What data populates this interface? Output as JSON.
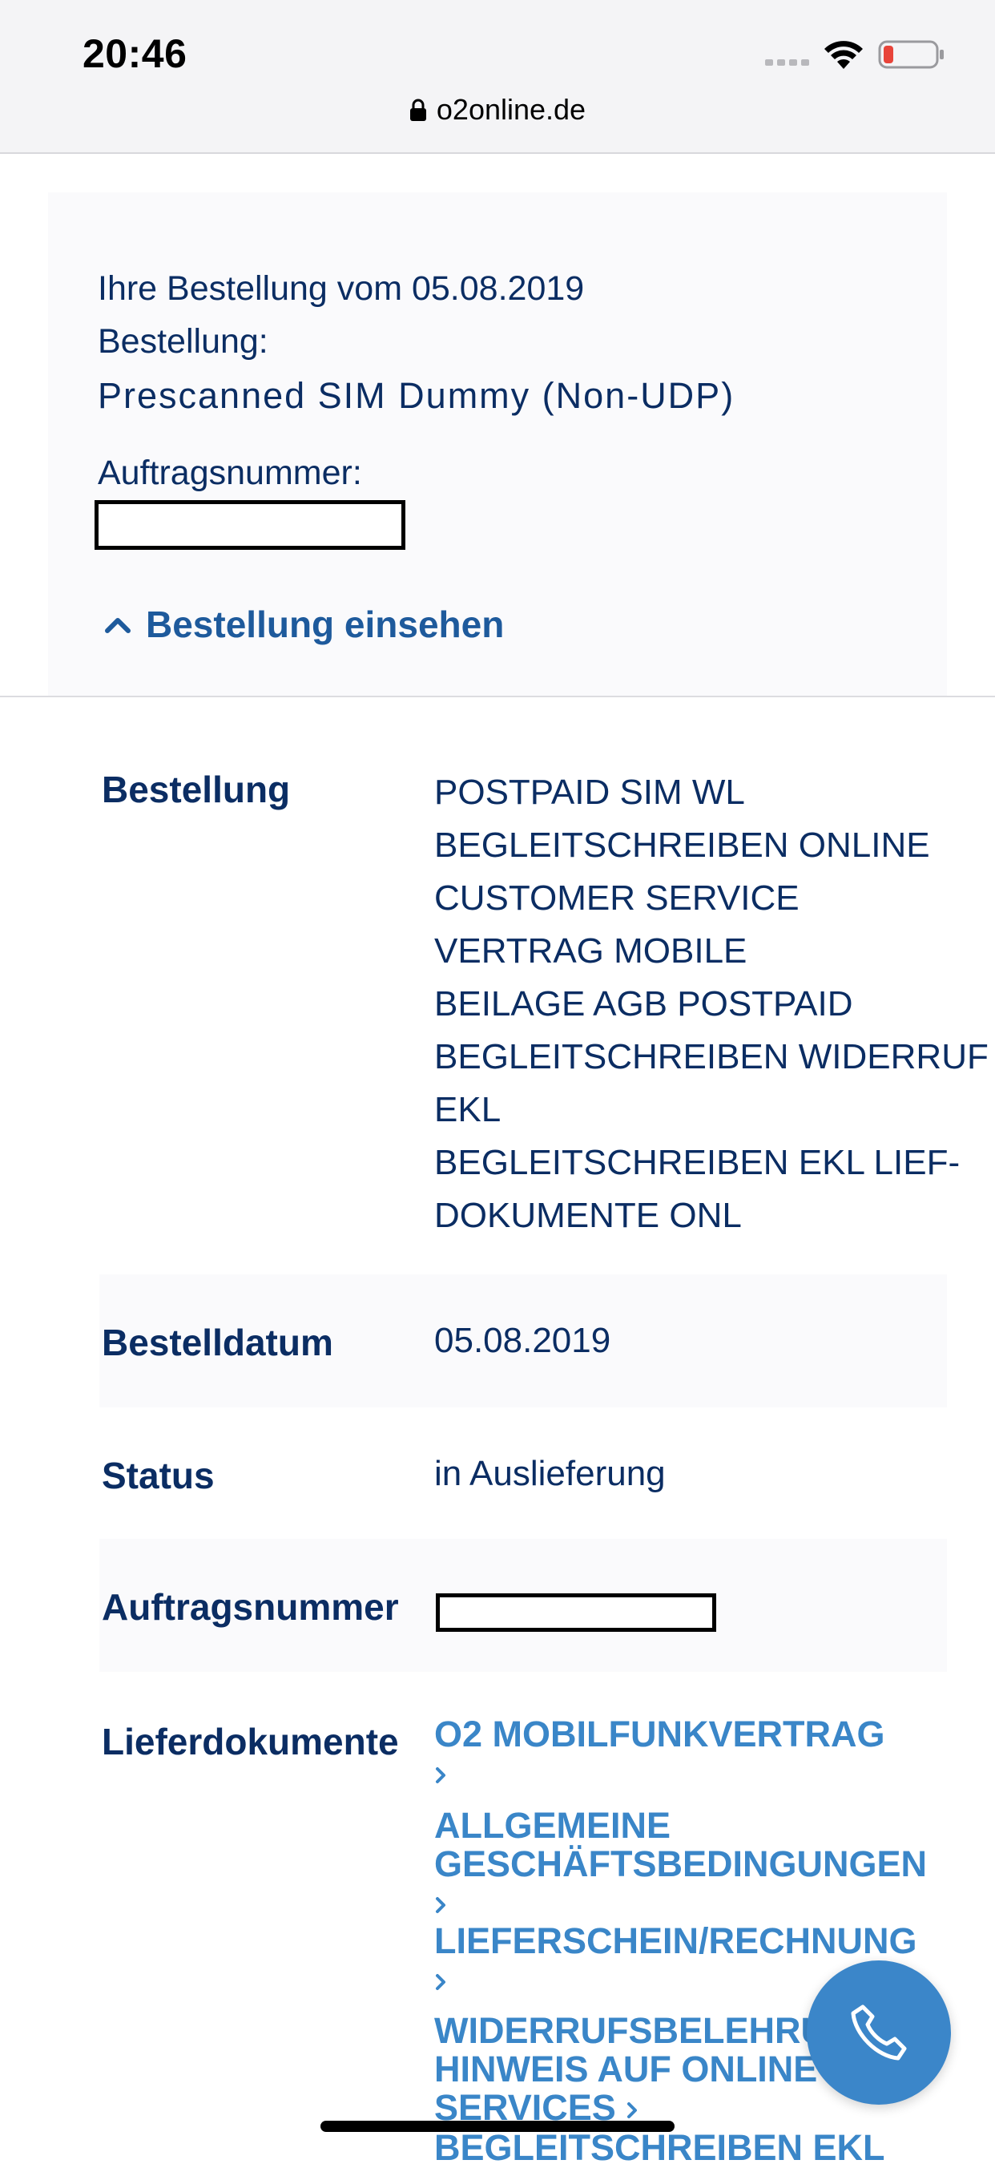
{
  "status_bar": {
    "time": "20:46"
  },
  "browser": {
    "url": "o2online.de"
  },
  "summary": {
    "order_date_line": "Ihre Bestellung vom 05.08.2019",
    "order_label": "Bestellung:",
    "product_name": "Prescanned SIM Dummy (Non-UDP)",
    "order_number_label": "Auftragsnummer:",
    "toggle_label": "Bestellung einsehen"
  },
  "details": {
    "order_label": "Bestellung",
    "order_items": [
      "POSTPAID SIM WL",
      "BEGLEITSCHREIBEN ONLINE",
      "CUSTOMER SERVICE",
      "VERTRAG MOBILE",
      "BEILAGE AGB POSTPAID",
      "BEGLEITSCHREIBEN WIDERRUF",
      "EKL",
      "BEGLEITSCHREIBEN EKL LIEF-",
      "DOKUMENTE ONL"
    ],
    "date_label": "Bestelldatum",
    "date_value": "05.08.2019",
    "status_label": "Status",
    "status_value": "in Auslieferung",
    "order_number_label": "Auftragsnummer",
    "documents_label": "Lieferdokumente",
    "documents": [
      "O2 MOBILFUNKVERTRAG",
      "ALLGEMEINE",
      "GESCHÄFTSBEDINGUNGEN",
      "LIEFERSCHEIN/RECHNUNG",
      "WIDERRUFSBELEHRU",
      "HINWEIS AUF ONLINE",
      "SERVICES",
      "BEGLEITSCHREIBEN EKL"
    ]
  },
  "colors": {
    "text": "#0b2d63",
    "link": "#1e5a9c",
    "doc_link": "#3a86c8",
    "call_button": "#3b86c9"
  },
  "icons": [
    "signal-icon",
    "wifi-icon",
    "battery-icon",
    "lock-icon",
    "chevron-up-icon",
    "chevron-right-icon",
    "phone-icon"
  ]
}
